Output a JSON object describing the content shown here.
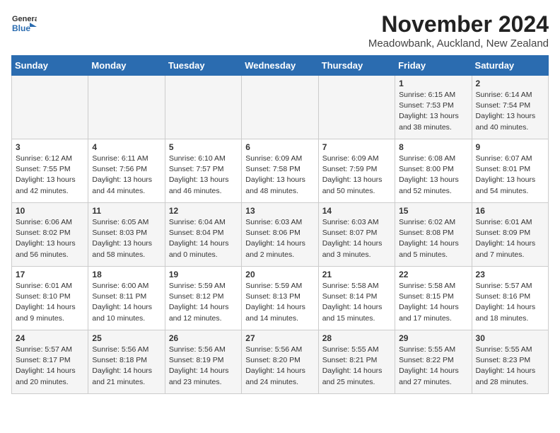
{
  "header": {
    "logo_line1": "General",
    "logo_line2": "Blue",
    "month": "November 2024",
    "location": "Meadowbank, Auckland, New Zealand"
  },
  "weekdays": [
    "Sunday",
    "Monday",
    "Tuesday",
    "Wednesday",
    "Thursday",
    "Friday",
    "Saturday"
  ],
  "weeks": [
    [
      {
        "day": "",
        "info": ""
      },
      {
        "day": "",
        "info": ""
      },
      {
        "day": "",
        "info": ""
      },
      {
        "day": "",
        "info": ""
      },
      {
        "day": "",
        "info": ""
      },
      {
        "day": "1",
        "info": "Sunrise: 6:15 AM\nSunset: 7:53 PM\nDaylight: 13 hours\nand 38 minutes."
      },
      {
        "day": "2",
        "info": "Sunrise: 6:14 AM\nSunset: 7:54 PM\nDaylight: 13 hours\nand 40 minutes."
      }
    ],
    [
      {
        "day": "3",
        "info": "Sunrise: 6:12 AM\nSunset: 7:55 PM\nDaylight: 13 hours\nand 42 minutes."
      },
      {
        "day": "4",
        "info": "Sunrise: 6:11 AM\nSunset: 7:56 PM\nDaylight: 13 hours\nand 44 minutes."
      },
      {
        "day": "5",
        "info": "Sunrise: 6:10 AM\nSunset: 7:57 PM\nDaylight: 13 hours\nand 46 minutes."
      },
      {
        "day": "6",
        "info": "Sunrise: 6:09 AM\nSunset: 7:58 PM\nDaylight: 13 hours\nand 48 minutes."
      },
      {
        "day": "7",
        "info": "Sunrise: 6:09 AM\nSunset: 7:59 PM\nDaylight: 13 hours\nand 50 minutes."
      },
      {
        "day": "8",
        "info": "Sunrise: 6:08 AM\nSunset: 8:00 PM\nDaylight: 13 hours\nand 52 minutes."
      },
      {
        "day": "9",
        "info": "Sunrise: 6:07 AM\nSunset: 8:01 PM\nDaylight: 13 hours\nand 54 minutes."
      }
    ],
    [
      {
        "day": "10",
        "info": "Sunrise: 6:06 AM\nSunset: 8:02 PM\nDaylight: 13 hours\nand 56 minutes."
      },
      {
        "day": "11",
        "info": "Sunrise: 6:05 AM\nSunset: 8:03 PM\nDaylight: 13 hours\nand 58 minutes."
      },
      {
        "day": "12",
        "info": "Sunrise: 6:04 AM\nSunset: 8:04 PM\nDaylight: 14 hours\nand 0 minutes."
      },
      {
        "day": "13",
        "info": "Sunrise: 6:03 AM\nSunset: 8:06 PM\nDaylight: 14 hours\nand 2 minutes."
      },
      {
        "day": "14",
        "info": "Sunrise: 6:03 AM\nSunset: 8:07 PM\nDaylight: 14 hours\nand 3 minutes."
      },
      {
        "day": "15",
        "info": "Sunrise: 6:02 AM\nSunset: 8:08 PM\nDaylight: 14 hours\nand 5 minutes."
      },
      {
        "day": "16",
        "info": "Sunrise: 6:01 AM\nSunset: 8:09 PM\nDaylight: 14 hours\nand 7 minutes."
      }
    ],
    [
      {
        "day": "17",
        "info": "Sunrise: 6:01 AM\nSunset: 8:10 PM\nDaylight: 14 hours\nand 9 minutes."
      },
      {
        "day": "18",
        "info": "Sunrise: 6:00 AM\nSunset: 8:11 PM\nDaylight: 14 hours\nand 10 minutes."
      },
      {
        "day": "19",
        "info": "Sunrise: 5:59 AM\nSunset: 8:12 PM\nDaylight: 14 hours\nand 12 minutes."
      },
      {
        "day": "20",
        "info": "Sunrise: 5:59 AM\nSunset: 8:13 PM\nDaylight: 14 hours\nand 14 minutes."
      },
      {
        "day": "21",
        "info": "Sunrise: 5:58 AM\nSunset: 8:14 PM\nDaylight: 14 hours\nand 15 minutes."
      },
      {
        "day": "22",
        "info": "Sunrise: 5:58 AM\nSunset: 8:15 PM\nDaylight: 14 hours\nand 17 minutes."
      },
      {
        "day": "23",
        "info": "Sunrise: 5:57 AM\nSunset: 8:16 PM\nDaylight: 14 hours\nand 18 minutes."
      }
    ],
    [
      {
        "day": "24",
        "info": "Sunrise: 5:57 AM\nSunset: 8:17 PM\nDaylight: 14 hours\nand 20 minutes."
      },
      {
        "day": "25",
        "info": "Sunrise: 5:56 AM\nSunset: 8:18 PM\nDaylight: 14 hours\nand 21 minutes."
      },
      {
        "day": "26",
        "info": "Sunrise: 5:56 AM\nSunset: 8:19 PM\nDaylight: 14 hours\nand 23 minutes."
      },
      {
        "day": "27",
        "info": "Sunrise: 5:56 AM\nSunset: 8:20 PM\nDaylight: 14 hours\nand 24 minutes."
      },
      {
        "day": "28",
        "info": "Sunrise: 5:55 AM\nSunset: 8:21 PM\nDaylight: 14 hours\nand 25 minutes."
      },
      {
        "day": "29",
        "info": "Sunrise: 5:55 AM\nSunset: 8:22 PM\nDaylight: 14 hours\nand 27 minutes."
      },
      {
        "day": "30",
        "info": "Sunrise: 5:55 AM\nSunset: 8:23 PM\nDaylight: 14 hours\nand 28 minutes."
      }
    ]
  ]
}
